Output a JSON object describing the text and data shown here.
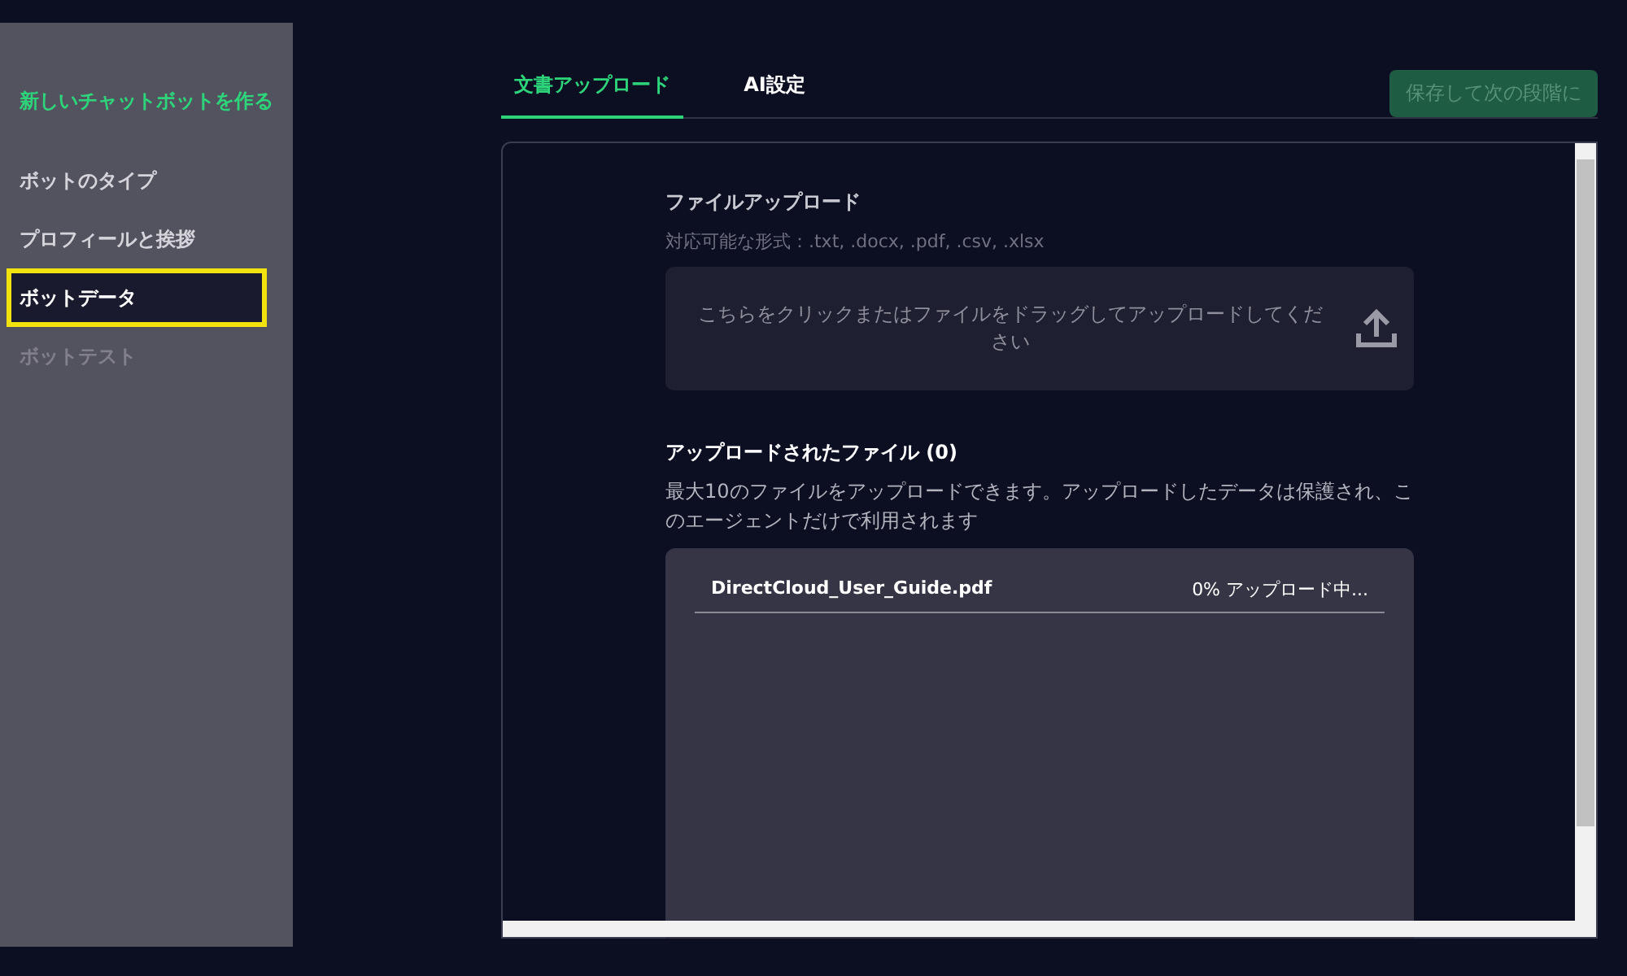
{
  "sidebar": {
    "title": "新しいチャットボットを作る",
    "items": [
      {
        "label": "ボットのタイプ",
        "selected": false,
        "disabled": false
      },
      {
        "label": "プロフィールと挨拶",
        "selected": false,
        "disabled": false
      },
      {
        "label": "ボットデータ",
        "selected": true,
        "disabled": false
      },
      {
        "label": "ボットテスト",
        "selected": false,
        "disabled": true
      }
    ]
  },
  "tabs": [
    {
      "label": "文書アップロード",
      "selected": true
    },
    {
      "label": "AI設定",
      "selected": false
    }
  ],
  "save_button": {
    "label": "保存して次の段階に",
    "disabled": true
  },
  "upload": {
    "title": "ファイルアップロード",
    "formats": "対応可能な形式：.txt, .docx, .pdf, .csv, .xlsx",
    "dropzone": "こちらをクリックまたはファイルをドラッグしてアップロードしてください"
  },
  "uploaded": {
    "title": "アップロードされたファイル (0)",
    "description": "最大10のファイルをアップロードできます。アップロードしたデータは保護され、このエージェントだけで利用されます",
    "files": [
      {
        "name": "DirectCloud_User_Guide.pdf",
        "status": "0% アップロード中..."
      }
    ]
  }
}
